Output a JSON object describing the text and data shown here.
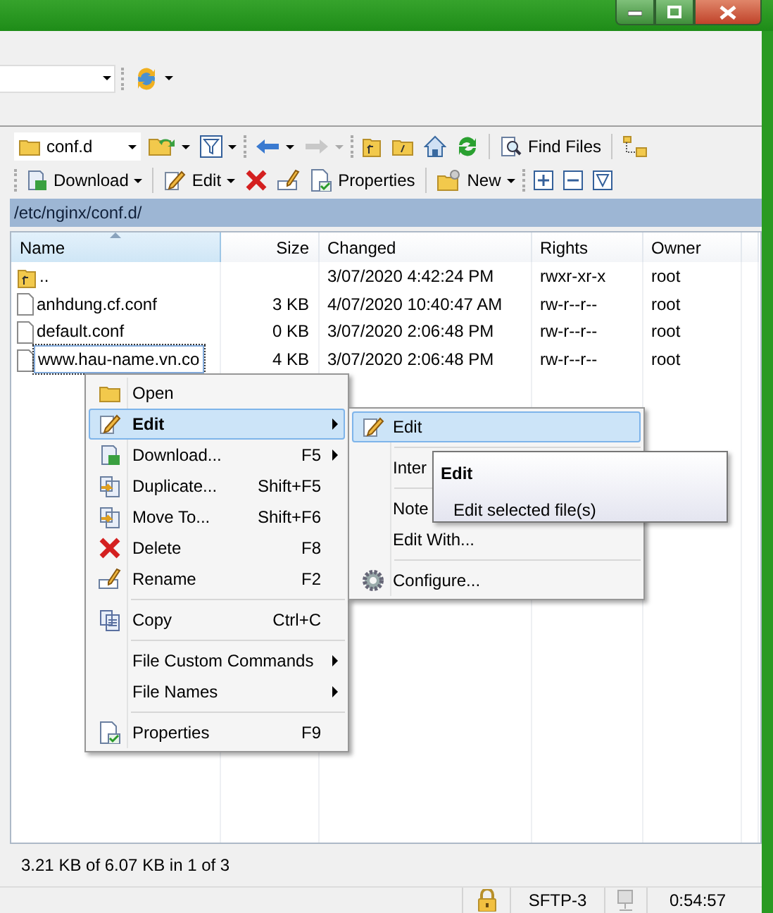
{
  "toolbar": {
    "path_combo": "conf.d",
    "find_files": "Find Files"
  },
  "file_toolbar": [
    {
      "label": "Download",
      "dropdown": true
    },
    {
      "label": "Edit",
      "dropdown": true
    },
    {
      "label": "Properties",
      "dropdown": false
    },
    {
      "label": "New",
      "dropdown": true
    }
  ],
  "path": "/etc/nginx/conf.d/",
  "table": {
    "columns": [
      {
        "label": "Name",
        "sorted": true
      },
      {
        "label": "Size",
        "sorted": false
      },
      {
        "label": "Changed",
        "sorted": false
      },
      {
        "label": "Rights",
        "sorted": false
      },
      {
        "label": "Owner",
        "sorted": false
      }
    ],
    "rows": [
      {
        "kind": "parent",
        "name": "..",
        "size": "",
        "changed": "3/07/2020 4:42:24 PM",
        "rights": "rwxr-xr-x",
        "owner": "root",
        "selected": false
      },
      {
        "kind": "file",
        "name": "anhdung.cf.conf",
        "size": "3 KB",
        "changed": "4/07/2020 10:40:47 AM",
        "rights": "rw-r--r--",
        "owner": "root",
        "selected": false
      },
      {
        "kind": "file",
        "name": "default.conf",
        "size": "0 KB",
        "changed": "3/07/2020 2:06:48 PM",
        "rights": "rw-r--r--",
        "owner": "root",
        "selected": false
      },
      {
        "kind": "file",
        "name": "www.hau-name.vn.co",
        "size": "4 KB",
        "changed": "3/07/2020 2:06:48 PM",
        "rights": "rw-r--r--",
        "owner": "root",
        "selected": true
      }
    ]
  },
  "context_menu": [
    {
      "kind": "item",
      "label": "Open",
      "submenu": false,
      "selected": false
    },
    {
      "kind": "item",
      "label": "Edit",
      "submenu": true,
      "selected": true
    },
    {
      "kind": "item",
      "label": "Download...",
      "shortcut": "F5",
      "submenu": true,
      "selected": false
    },
    {
      "kind": "item",
      "label": "Duplicate...",
      "shortcut": "Shift+F5",
      "submenu": false,
      "selected": false
    },
    {
      "kind": "item",
      "label": "Move To...",
      "shortcut": "Shift+F6",
      "submenu": false,
      "selected": false
    },
    {
      "kind": "item",
      "label": "Delete",
      "shortcut": "F8",
      "submenu": false,
      "selected": false
    },
    {
      "kind": "item",
      "label": "Rename",
      "shortcut": "F2",
      "submenu": false,
      "selected": false
    },
    {
      "kind": "separator"
    },
    {
      "kind": "item",
      "label": "Copy",
      "shortcut": "Ctrl+C",
      "submenu": false,
      "selected": false
    },
    {
      "kind": "separator"
    },
    {
      "kind": "item",
      "label": "File Custom Commands",
      "submenu": true,
      "selected": false
    },
    {
      "kind": "item",
      "label": "File Names",
      "submenu": true,
      "selected": false
    },
    {
      "kind": "separator"
    },
    {
      "kind": "item",
      "label": "Properties",
      "shortcut": "F9",
      "submenu": false,
      "selected": false
    }
  ],
  "submenu": [
    {
      "kind": "item",
      "label": "Edit",
      "selected": true
    },
    {
      "kind": "separator"
    },
    {
      "kind": "item",
      "label": "Inter",
      "selected": false
    },
    {
      "kind": "separator"
    },
    {
      "kind": "item",
      "label": "Note",
      "selected": false
    },
    {
      "kind": "item",
      "label": "Edit With...",
      "selected": false
    },
    {
      "kind": "separator"
    },
    {
      "kind": "item",
      "label": "Configure...",
      "selected": false
    }
  ],
  "tooltip": {
    "title": "Edit",
    "text": "Edit selected file(s)"
  },
  "status": {
    "text": "3.21 KB of 6.07 KB in 1 of 3",
    "protocol": "SFTP-3",
    "time": "0:54:57"
  }
}
